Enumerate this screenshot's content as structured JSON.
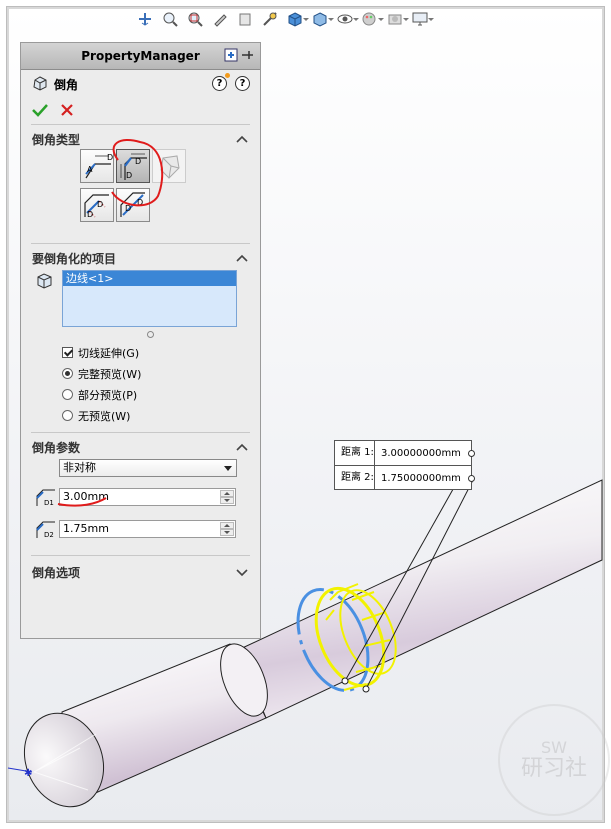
{
  "pm": {
    "header": "PropertyManager",
    "feature_title": "倒角",
    "help_q": "?",
    "help_q2": "?"
  },
  "sections": {
    "type": {
      "title": "倒角类型"
    },
    "items": {
      "title": "要倒角化的项目",
      "list": [
        "边线<1>"
      ]
    },
    "params": {
      "title": "倒角参数",
      "mode": "非对称",
      "d1": "3.00mm",
      "d2": "1.75mm"
    },
    "options": {
      "title": "倒角选项"
    }
  },
  "items_options": {
    "tangent": "切线延伸(G)",
    "full_preview": "完整预览(W)",
    "partial_preview": "部分预览(P)",
    "no_preview": "无预览(W)"
  },
  "icon_labels": {
    "btn1_a": "A",
    "btn1_d": "D",
    "btn2_d1": "D",
    "btn2_d2": "D",
    "btn3_d1": "D",
    "btn3_d2": "D",
    "btn4_d1": "D",
    "btn4_d2": "D",
    "d1": "D1",
    "d2": "D2"
  },
  "callout": {
    "label1": "距离 1:",
    "value1": "3.00000000mm",
    "label2": "距离 2:",
    "value2": "1.75000000mm"
  },
  "watermark": {
    "line1": "SW",
    "line2": "研习社"
  },
  "colors": {
    "selection": "#3b86d6",
    "preview_yellow": "#f2f200",
    "preview_blue": "#4a90e2",
    "annotation_red": "#e01b1b",
    "ok_green": "#2aa12a",
    "cancel_red": "#d42020"
  }
}
